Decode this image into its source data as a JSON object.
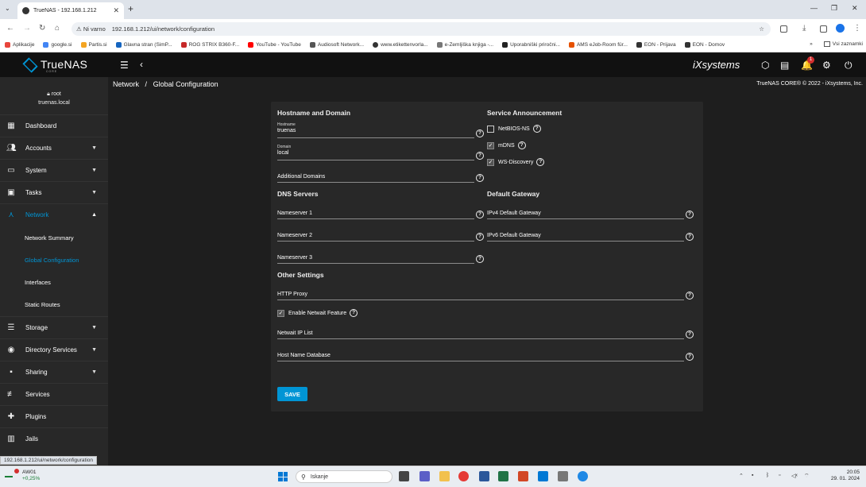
{
  "browser": {
    "tab_title": "TrueNAS - 192.168.1.212",
    "security_label": "Ni varno",
    "url": "192.168.1.212/ui/network/configuration",
    "bookmarks": [
      "Aplikacije",
      "google.si",
      "Partis.si",
      "Glavna stran (SimP...",
      "ROG STRIX B360-F...",
      "YouTube - YouTube",
      "Audiosoft Network...",
      "www.etikettenvorla...",
      "e-Zemljiška knjiga -...",
      "Uporabniški priročni...",
      "AMS eJob-Room für...",
      "EON - Prijava",
      "EON - Domov"
    ],
    "bookmarks_more": "»",
    "all_bookmarks": "Vsi zaznamki",
    "status_url": "192.168.1.212/ui/network/configuration"
  },
  "header": {
    "logo_text": "TrueNAS",
    "logo_sub": "CORE",
    "vendor": "iXsystems",
    "notification_count": "1"
  },
  "breadcrumb": {
    "parent": "Network",
    "separator": "/",
    "current": "Global Configuration"
  },
  "copyright": "TrueNAS CORE® © 2022 - iXsystems, Inc.",
  "user": {
    "name": "root",
    "host": "truenas.local"
  },
  "sidebar": {
    "items": [
      {
        "label": "Dashboard",
        "icon": "dashboard-icon"
      },
      {
        "label": "Accounts",
        "icon": "accounts-icon"
      },
      {
        "label": "System",
        "icon": "system-icon"
      },
      {
        "label": "Tasks",
        "icon": "tasks-icon"
      },
      {
        "label": "Network",
        "icon": "network-icon"
      },
      {
        "label": "Storage",
        "icon": "storage-icon"
      },
      {
        "label": "Directory Services",
        "icon": "directory-icon"
      },
      {
        "label": "Sharing",
        "icon": "sharing-icon"
      },
      {
        "label": "Services",
        "icon": "services-icon"
      },
      {
        "label": "Plugins",
        "icon": "plugins-icon"
      },
      {
        "label": "Jails",
        "icon": "jails-icon"
      }
    ],
    "network_sub": [
      "Network Summary",
      "Global Configuration",
      "Interfaces",
      "Static Routes"
    ]
  },
  "form": {
    "hostname_section": "Hostname and Domain",
    "hostname_label": "Hostname",
    "hostname_value": "truenas",
    "domain_label": "Domain",
    "domain_value": "local",
    "additional_domains": "Additional Domains",
    "service_section": "Service Announcement",
    "netbios": "NetBIOS-NS",
    "mdns": "mDNS",
    "wsd": "WS-Discovery",
    "dns_section": "DNS Servers",
    "ns1": "Nameserver 1",
    "ns2": "Nameserver 2",
    "ns3": "Nameserver 3",
    "gateway_section": "Default Gateway",
    "ipv4_gw": "IPv4 Default Gateway",
    "ipv6_gw": "IPv6 Default Gateway",
    "other_section": "Other Settings",
    "http_proxy": "HTTP Proxy",
    "netwait": "Enable Netwait Feature",
    "netwait_ip": "Netwait IP List",
    "host_db": "Host Name Database",
    "save": "SAVE"
  },
  "taskbar": {
    "stock_name": "AW01",
    "stock_change": "+0,25%",
    "search_placeholder": "Iskanje",
    "time": "20:05",
    "date": "29. 01. 2024"
  }
}
